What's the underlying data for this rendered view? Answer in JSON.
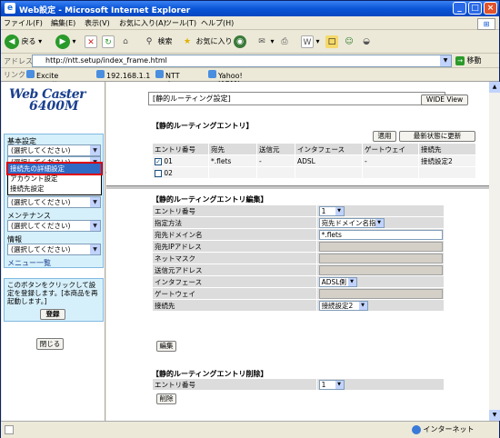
{
  "window": {
    "title": "Web設定 - Microsoft Internet Explorer"
  },
  "menu": [
    "ファイル(F)",
    "編集(E)",
    "表示(V)",
    "お気に入り(A)",
    "ツール(T)",
    "ヘルプ(H)"
  ],
  "toolbar": {
    "back": "戻る",
    "search": "検索",
    "favorites": "お気に入り"
  },
  "address": {
    "label": "アドレス(D)",
    "url": "http://ntt.setup/index_frame.html",
    "go": "移動"
  },
  "links": {
    "label": "リンク",
    "items": [
      "Excite エキサイト",
      "192.168.1.1",
      "NTT東日本",
      "Yahoo! JAPAN"
    ]
  },
  "logo": {
    "line1": "Web Caster",
    "line2": "6400M"
  },
  "nav": {
    "basic_label": "基本設定",
    "placeholder": "(選択してください)",
    "dropdown_items": [
      "接続先の詳細設定",
      "アカウント設定",
      "接続先設定"
    ],
    "maintenance_label": "メンテナンス",
    "info_label": "情報",
    "menu_list": "メニュー一覧",
    "message": "このボタンをクリックして設定を登録します。[本商品を再起動します。]",
    "register": "登録",
    "close": "閉じる"
  },
  "annotation": {
    "label": "選択"
  },
  "top": {
    "section": "[静的ルーティング設定]",
    "wide_view": "WIDE View",
    "entry_title": "【静的ルーティングエントリ】",
    "apply": "適用",
    "refresh": "最新状態に更新",
    "headers": [
      "エントリ番号",
      "宛先",
      "送信元",
      "インタフェース",
      "ゲートウェイ",
      "接続先"
    ],
    "rows": [
      {
        "num": "01",
        "dest": "*.flets",
        "src": "-",
        "iface": "ADSL",
        "gw": "-",
        "conn": "接続設定2",
        "checked": true
      },
      {
        "num": "02",
        "dest": "",
        "src": "",
        "iface": "",
        "gw": "",
        "conn": "",
        "checked": false
      }
    ]
  },
  "edit": {
    "title": "【静的ルーティングエントリ編集】",
    "fields": [
      {
        "label": "エントリ番号",
        "value": "1"
      },
      {
        "label": "指定方法",
        "value": "宛先ドメイン名指定"
      },
      {
        "label": "宛先ドメイン名",
        "value": "*.flets"
      },
      {
        "label": "宛先IPアドレス",
        "value": ""
      },
      {
        "label": "ネットマスク",
        "value": ""
      },
      {
        "label": "送信元アドレス",
        "value": ""
      },
      {
        "label": "インタフェース",
        "value": "ADSL側"
      },
      {
        "label": "ゲートウェイ",
        "value": ""
      },
      {
        "label": "接続先",
        "value": "接続設定2"
      }
    ],
    "edit_button": "編集"
  },
  "delete": {
    "title": "【静的ルーティングエントリ削除】",
    "entry_label": "エントリ番号",
    "entry_value": "1",
    "delete_button": "削除"
  },
  "status": {
    "zone": "インターネット"
  },
  "colors": {
    "title_bar": "#0a55d8",
    "nav_panel": "#d6f0fb",
    "highlight": "#316ac5",
    "annotation": "#d00000"
  }
}
